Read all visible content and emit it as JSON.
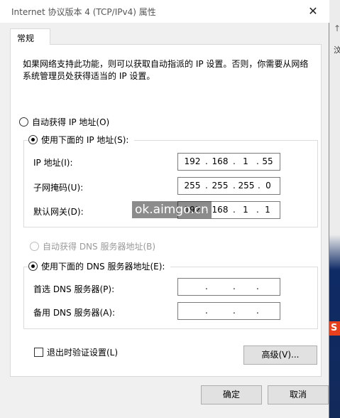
{
  "window": {
    "title": "Internet 协议版本 4 (TCP/IPv4) 属性",
    "close_glyph": "✕"
  },
  "tabs": [
    {
      "label": "常规"
    }
  ],
  "description": "如果网络支持此功能，则可以获取自动指派的 IP 设置。否则，你需要从网络系统管理员处获得适当的 IP 设置。",
  "ip_section": {
    "auto_label": "自动获得 IP 地址(O)",
    "manual_label": "使用下面的 IP 地址(S):",
    "selected": "manual",
    "fields": [
      {
        "label": "IP 地址(I):",
        "octets": [
          "192",
          "168",
          "1",
          "55"
        ]
      },
      {
        "label": "子网掩码(U):",
        "octets": [
          "255",
          "255",
          "255",
          "0"
        ]
      },
      {
        "label": "默认网关(D):",
        "octets": [
          "192",
          "168",
          "1",
          "1"
        ]
      }
    ]
  },
  "dns_section": {
    "auto_label": "自动获得 DNS 服务器地址(B)",
    "manual_label": "使用下面的 DNS 服务器地址(E):",
    "selected": "manual",
    "fields": [
      {
        "label": "首选 DNS 服务器(P):",
        "octets": [
          "",
          "",
          "",
          ""
        ]
      },
      {
        "label": "备用 DNS 服务器(A):",
        "octets": [
          "",
          "",
          "",
          ""
        ]
      }
    ]
  },
  "validate_label": "退出时验证设置(L)",
  "buttons": {
    "advanced": "高级(V)...",
    "ok": "确定",
    "cancel": "取消"
  },
  "watermark": "ok.aimgo.cn",
  "desktop": {
    "badge": "S",
    "glyph": "汶",
    "arrow": "↑"
  },
  "colors": {
    "accent_badge": "#e8401c",
    "disabled_text": "#9a9a9a"
  }
}
